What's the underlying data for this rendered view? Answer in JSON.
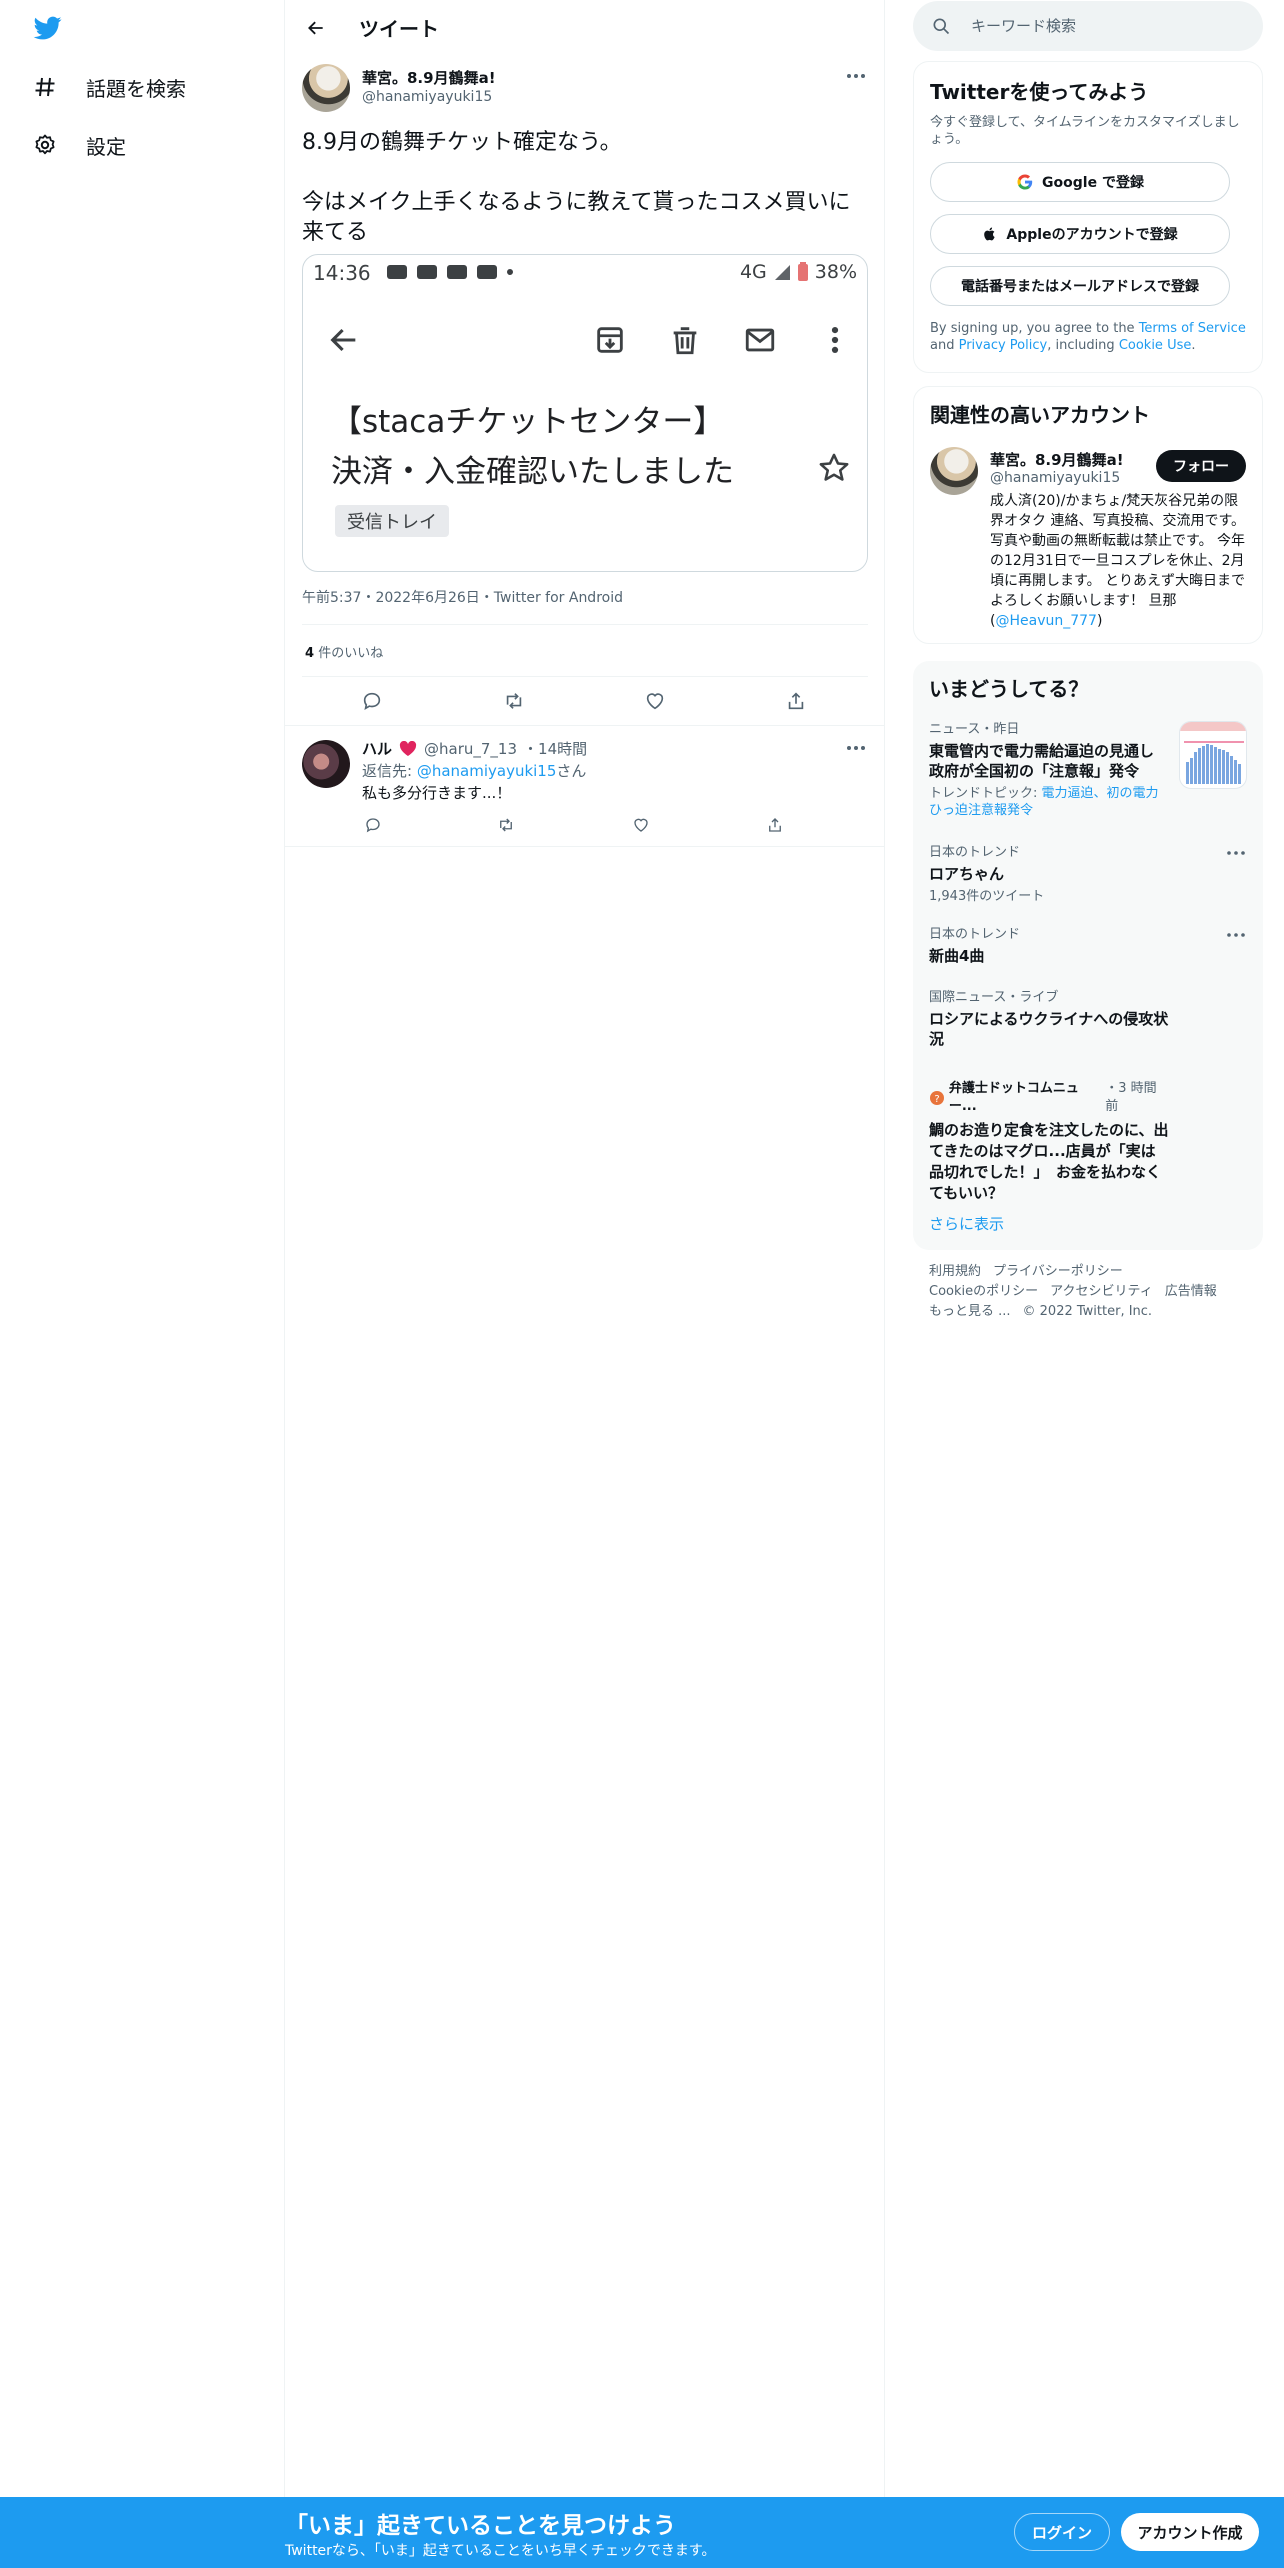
{
  "nav": {
    "items": [
      {
        "label": "話題を検索",
        "icon": "hashtag-icon"
      },
      {
        "label": "設定",
        "icon": "gear-icon"
      }
    ]
  },
  "header": {
    "title": "ツイート"
  },
  "tweet": {
    "author_name": "華宮。8.9月鶴舞a!",
    "author_handle": "@hanamiyayuki15",
    "text": "8.9月の鶴舞チケット確定なう。\n\n今はメイク上手くなるように教えて貰ったコスメ買いに来てる",
    "media": {
      "status_time": "14:36",
      "network": "4G",
      "battery": "38%",
      "subject": "【stacaチケットセンター】\n決済・入金確認いたしました",
      "label": "受信トレイ"
    },
    "meta": "午前5:37・2022年6月26日・Twitter for Android",
    "like_count": "4",
    "like_label": "件のいいね"
  },
  "reply": {
    "name": "ハル",
    "handle": "@haru_7_13",
    "time": "・14時間",
    "reply_prefix": "返信先: ",
    "reply_to": "@hanamiyayuki15",
    "reply_suffix": "さん",
    "text": "私も多分行きます...！"
  },
  "search": {
    "placeholder": "キーワード検索"
  },
  "signup": {
    "title": "Twitterを使ってみよう",
    "subtitle": "今すぐ登録して、タイムラインをカスタマイズしましょう。",
    "google": "Google で登録",
    "apple": "Appleのアカウントで登録",
    "phone": "電話番号またはメールアドレスで登録",
    "legal_1": "By signing up, you agree to the ",
    "legal_tos": "Terms of Service",
    "legal_2": " and ",
    "legal_privacy": "Privacy Policy",
    "legal_3": ", including ",
    "legal_cookie": "Cookie Use",
    "legal_4": "."
  },
  "related": {
    "title": "関連性の高いアカウント",
    "name": "華宮。8.9月鶴舞a!",
    "handle": "@hanamiyayuki15",
    "follow": "フォロー",
    "bio": "成人済(20)/かまちょ/梵天灰谷兄弟の限界オタク 連絡、写真投稿、交流用です。 写真や動画の無断転載は禁止です。 今年の12月31日で一旦コスプレを休止、2月頃に再開します。 とりあえず大晦日までよろしくお願いします！ 旦那(",
    "bio_link": "@Heavun_777",
    "bio_end": ")"
  },
  "trends": {
    "title": "いまどうしてる？",
    "items": [
      {
        "meta": "ニュース・昨日",
        "name": "東電管内で電力需給逼迫の見通し 政府が全国初の「注意報」発令",
        "sub_prefix": "トレンドトピック: ",
        "sub_link": "電力逼迫、初の電力ひっ迫注意報発令"
      },
      {
        "meta": "日本のトレンド",
        "name": "ロアちゃん",
        "sub": "1,943件のツイート"
      },
      {
        "meta": "日本のトレンド",
        "name": "新曲4曲"
      },
      {
        "meta": "国際ニュース・ライブ",
        "name": "ロシアによるウクライナへの侵攻状況"
      },
      {
        "meta_source": "弁護士ドットコムニュー...",
        "meta_time": "・3 時間前",
        "name": "鯛のお造り定食を注文したのに、出てきたのはマグロ...店員が「実は品切れでした！」　お金を払わなくてもいい？"
      }
    ],
    "show_more": "さらに表示"
  },
  "footer": {
    "links": [
      "利用規約",
      "プライバシーポリシー",
      "Cookieのポリシー",
      "アクセシビリティ",
      "広告情報",
      "もっと見る ...",
      "© 2022 Twitter, Inc."
    ]
  },
  "bottombar": {
    "title": "「いま」起きていることを見つけよう",
    "subtitle": "Twitterなら、「いま」起きていることをいち早くチェックできます。",
    "login": "ログイン",
    "signup": "アカウント作成"
  },
  "colors": {
    "accent": "#1d9bf0",
    "text": "#0f1419",
    "secondary": "#536471"
  }
}
